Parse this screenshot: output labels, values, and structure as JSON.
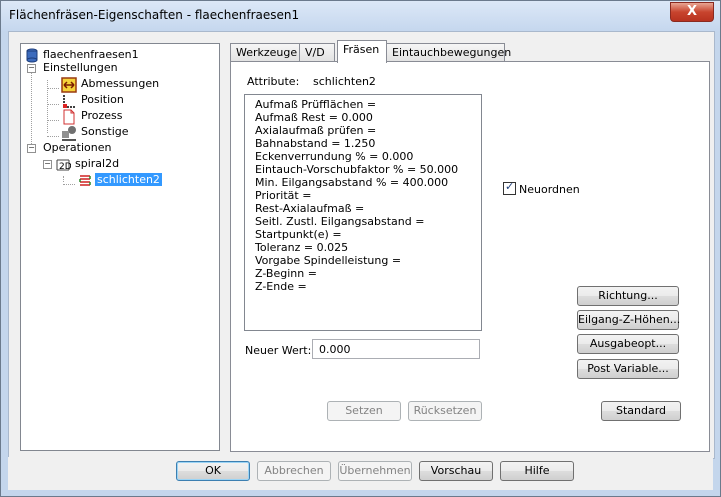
{
  "window": {
    "title": "Flächenfräsen-Eigenschaften - flaechenfraesen1",
    "close_glyph": "X"
  },
  "tree": {
    "root": "flaechenfraesen1",
    "settings_label": "Einstellungen",
    "settings_children": [
      "Abmessungen",
      "Position",
      "Prozess",
      "Sonstige"
    ],
    "operations_label": "Operationen",
    "operation": "spiral2d",
    "suboperation": "schlichten2"
  },
  "tabs": [
    "Werkzeuge",
    "V/D",
    "Fräsen",
    "Eintauchbewegungen"
  ],
  "active_tab": "Fräsen",
  "attribute": {
    "label": "Attribute:",
    "value": "schlichten2"
  },
  "attributes_list": [
    "Aufmaß Prüfflächen =",
    "Aufmaß Rest = 0.000",
    "Axialaufmaß prüfen =",
    "Bahnabstand = 1.250",
    "Eckenverrundung % = 0.000",
    "Eintauch-Vorschubfaktor % = 50.000",
    "Min. Eilgangsabstand % = 400.000",
    "Priorität =",
    "Rest-Axialaufmaß =",
    "Seitl. Zustl. Eilgangsabstand =",
    "Startpunkt(e) =",
    "Toleranz = 0.025",
    "Vorgabe Spindelleistung =",
    "Z-Beginn =",
    "Z-Ende ="
  ],
  "reorder_checkbox": {
    "label": "Neuordnen",
    "checked": true
  },
  "new_value": {
    "label": "Neuer Wert:",
    "value": "0.000"
  },
  "panel_buttons": {
    "set": "Setzen",
    "reset": "Rücksetzen",
    "direction": "Richtung...",
    "rapid_z": "Eilgang-Z-Höhen...",
    "output_options": "Ausgabeopt...",
    "post_variable": "Post Variable...",
    "standard": "Standard"
  },
  "footer_buttons": {
    "ok": "OK",
    "cancel": "Abbrechen",
    "apply": "Übernehmen",
    "preview": "Vorschau",
    "help": "Hilfe"
  }
}
